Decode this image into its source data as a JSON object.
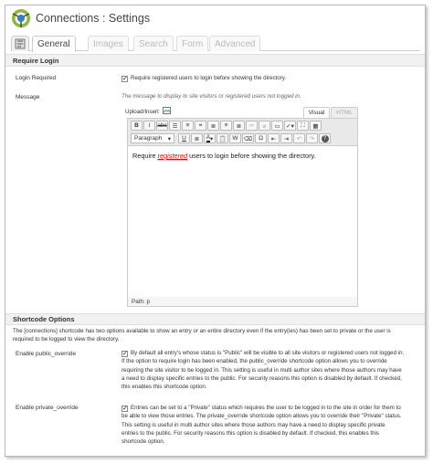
{
  "header": {
    "title": "Connections : Settings",
    "logo_icon": "connections-logo-icon"
  },
  "tabs": [
    {
      "label": "General",
      "active": true
    },
    {
      "label": "Images",
      "active": false
    },
    {
      "label": "Search",
      "active": false
    },
    {
      "label": "Form",
      "active": false
    },
    {
      "label": "Advanced",
      "active": false
    }
  ],
  "require_login": {
    "section_title": "Require Login",
    "login_required": {
      "label": "Login Required",
      "checked": true,
      "text": "Require registered users to login before showing the directory."
    },
    "message": {
      "label": "Message",
      "description": "The message to display to site visitors or registered users not logged in.",
      "upload_insert": "Upload/Insert",
      "tab_visual": "Visual",
      "tab_html": "HTML",
      "format_select": "Paragraph",
      "content_before": "Require ",
      "content_link": "registered",
      "content_after": " users to login before showing the directory.",
      "path_label": "Path:",
      "path_value": "p"
    }
  },
  "shortcode": {
    "section_title": "Shortcode Options",
    "intro_line1": "The [connections] shortcode has two options available to show an entry or an entire directory even if the entry(ies) has been set to private or the user is",
    "intro_line2": "required to be logged to view the directory.",
    "public_override": {
      "label": "Enable public_override",
      "checked": true,
      "lines": [
        "By default all entry's whose status is \"Public\" will be visible to all site visitors or registered users not logged in.",
        "If the option to require login has been enabled, the public_override shortcode option allows you to override",
        "requiring the site visitor to be logged in. This setting is useful in multi author sites where those authors may have",
        "a need to display specific entries to the public. For security reasons this option is disabled by default. If checked,",
        "this enables this shortcode option."
      ]
    },
    "private_override": {
      "label": "Enable private_override",
      "checked": true,
      "lines": [
        "Entries can be set to a \"Private\" status which requires the user to be logged in to the site in order for them to",
        "be able to view those entries. The private_override shortcode option allows you to override their \"Private\" status.",
        "This setting is useful in multi author sites where those authors may have a need to display specific private",
        "entries to the public. For security reasons this option is disabled by default. If checked, this enables this",
        "shortcode option."
      ]
    }
  }
}
